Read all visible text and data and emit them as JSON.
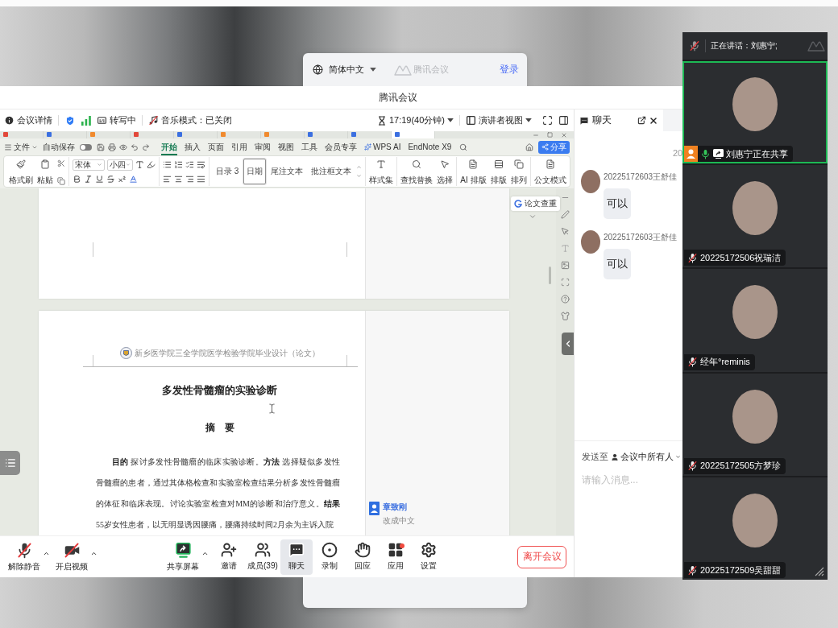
{
  "login_card": {
    "language": "简体中文",
    "brand": "腾讯会议",
    "login": "登录"
  },
  "window": {
    "title": "腾讯会议"
  },
  "info_bar": {
    "details": "会议详情",
    "transcription": "转写中",
    "music_mode": "音乐模式：已关闭",
    "timer": "17:19(40分钟)",
    "view_mode": "演讲者视图"
  },
  "shared_screen": {
    "doc_tabs": [
      {
        "color": "#e2483a",
        "selected": false
      },
      {
        "color": "#3b6fe0",
        "selected": false
      },
      {
        "color": "#f08a2e",
        "selected": false
      },
      {
        "color": "#e2483a",
        "selected": false
      },
      {
        "color": "#3b6fe0",
        "selected": false
      },
      {
        "color": "#f08a2e",
        "selected": false
      },
      {
        "color": "#f08a2e",
        "selected": false
      },
      {
        "color": "#3b6fe0",
        "selected": false
      },
      {
        "color": "#3b6fe0",
        "selected": false
      },
      {
        "color": "#3b6fe0",
        "selected": true
      }
    ],
    "menu": {
      "file": "文件",
      "autosave": {
        "label": "自动保存",
        "on": false
      },
      "tabs": [
        {
          "kind": "text",
          "label": "开始",
          "selected": true
        },
        {
          "kind": "text",
          "label": "插入",
          "selected": false
        },
        {
          "kind": "text",
          "label": "页面",
          "selected": false
        },
        {
          "kind": "text",
          "label": "引用",
          "selected": false
        },
        {
          "kind": "text",
          "label": "审阅",
          "selected": false
        },
        {
          "kind": "text",
          "label": "视图",
          "selected": false
        },
        {
          "kind": "text",
          "label": "工具",
          "selected": false
        },
        {
          "kind": "text",
          "label": "会员专享",
          "selected": false
        },
        {
          "kind": "ai",
          "label": "WPS AI",
          "selected": false
        },
        {
          "kind": "text",
          "label": "EndNote X9",
          "selected": false
        }
      ],
      "share": "分享"
    },
    "ribbon": {
      "clipboard": [
        {
          "kind": "format_painter",
          "label": "格式刷"
        },
        {
          "kind": "paste",
          "label": "粘贴"
        }
      ],
      "font": "宋体",
      "size": "小四",
      "styles": [
        {
          "label": "目录 3",
          "selected": false
        },
        {
          "label": "日期",
          "selected": true
        },
        {
          "label": "尾注文本",
          "selected": false
        },
        {
          "label": "批注框文本",
          "selected": false
        }
      ],
      "tool_groups": [
        [
          {
            "kind": "style_set",
            "label": "样式集"
          }
        ],
        [
          {
            "kind": "find_replace",
            "label": "查找替换"
          },
          {
            "kind": "select",
            "label": "选择"
          }
        ],
        [
          {
            "kind": "ai_layout",
            "label": "AI 排版"
          },
          {
            "kind": "layout",
            "label": "排版"
          },
          {
            "kind": "arrange",
            "label": "排列"
          }
        ],
        [
          {
            "kind": "official",
            "label": "公文模式"
          }
        ]
      ]
    },
    "check_button": "论文查重",
    "document": {
      "header": "新乡医学院三全学院医学检验学院毕业设计（论文）",
      "title": "多发性骨髓瘤的实验诊断",
      "abstract_heading": "摘　要",
      "body": "**目的** 探讨多发性骨髓瘤的临床实验诊断。**方法** 选择疑似多发性骨髓瘤的患者，通过其体格检查和实验室检查结果分析多发性骨髓瘤的体征和临床表现。讨论实验室检查对MM的诊断和治疗意义。**结果** 55岁女性患者，以无明显诱因腰痛，腰痛持续时间2月余为主诉入院",
      "comment": {
        "author": "章致刚",
        "text": "改成中文"
      }
    }
  },
  "toolbar": {
    "items": [
      {
        "kind": "unmute",
        "label": "解除静音",
        "menu": true,
        "selected": false,
        "badge": false
      },
      {
        "kind": "video",
        "label": "开启视频",
        "menu": true,
        "selected": false,
        "badge": false
      },
      {
        "kind": "share_screen",
        "label": "共享屏幕",
        "menu": true,
        "selected": false,
        "badge": false
      },
      {
        "kind": "invite",
        "label": "邀请",
        "menu": false,
        "selected": false,
        "badge": false
      },
      {
        "kind": "members",
        "label": "成员(39)",
        "menu": false,
        "selected": false,
        "badge": false
      },
      {
        "kind": "chat",
        "label": "聊天",
        "menu": false,
        "selected": true,
        "badge": false
      },
      {
        "kind": "record",
        "label": "录制",
        "menu": false,
        "selected": false,
        "badge": false
      },
      {
        "kind": "react",
        "label": "回应",
        "menu": false,
        "selected": false,
        "badge": false
      },
      {
        "kind": "apps",
        "label": "应用",
        "menu": false,
        "selected": false,
        "badge": true
      },
      {
        "kind": "settings",
        "label": "设置",
        "menu": false,
        "selected": false,
        "badge": false
      }
    ],
    "leave": "离开会议"
  },
  "chat": {
    "title": "聊天",
    "timestamp": "20",
    "messages": [
      {
        "sender": "20225172603王舒佳",
        "text": "可以"
      },
      {
        "sender": "20225172603王舒佳",
        "text": "可以"
      }
    ],
    "send_to": "发送至",
    "recipient": "会议中所有人",
    "placeholder": "请输入消息..."
  },
  "participants": {
    "speaking": "正在讲话：刘惠宁;",
    "tiles": [
      {
        "name": "刘惠宁正在共享",
        "selected": true,
        "host": true,
        "muted": false,
        "sharing": true
      },
      {
        "name": "20225172506祝瑞洁",
        "selected": false,
        "host": false,
        "muted": true,
        "sharing": false
      },
      {
        "name": "经年°reminis",
        "selected": false,
        "host": false,
        "muted": true,
        "sharing": false
      },
      {
        "name": "20225172505方梦珍",
        "selected": false,
        "host": false,
        "muted": true,
        "sharing": false
      },
      {
        "name": "20225172509吴甜甜",
        "selected": false,
        "host": false,
        "muted": true,
        "sharing": false
      }
    ]
  }
}
